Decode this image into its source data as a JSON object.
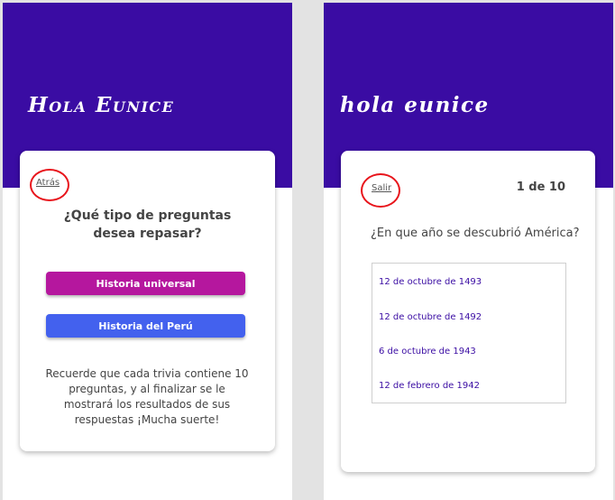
{
  "colors": {
    "header_band": "#3a0ca3",
    "universal_button": "#b5179e",
    "peru_button": "#4361ee",
    "annotation_circle": "#e8141b",
    "option_text": "#3a0ca3"
  },
  "left_screen": {
    "greeting": "Hola Eunice",
    "back_link": "Atrás",
    "question": "¿Qué tipo de preguntas desea repasar?",
    "buttons": {
      "universal": "Historia universal",
      "peru": "Historia del Perú"
    },
    "note": "Recuerde que cada trivia contiene 10 preguntas, y al finalizar se le mostrará los resultados de sus respuestas ¡Mucha suerte!"
  },
  "right_screen": {
    "greeting": "hola eunice",
    "exit_link": "Salir",
    "counter": "1 de 10",
    "question": "¿En que año se descubrió América?",
    "options": [
      "12 de octubre de 1493",
      "12 de octubre de 1492",
      "6 de octubre de 1943",
      "12 de febrero de 1942"
    ]
  }
}
